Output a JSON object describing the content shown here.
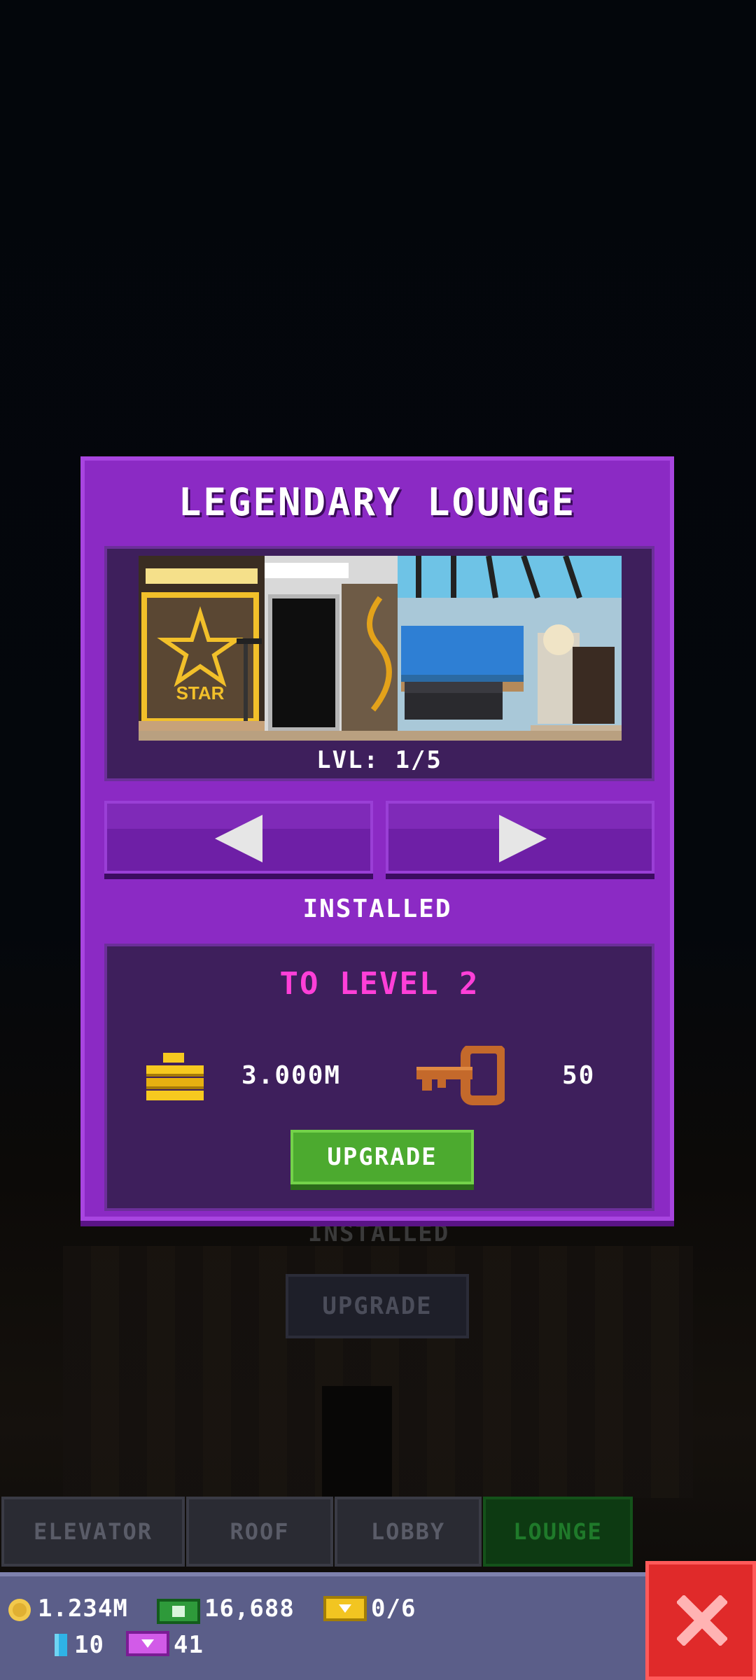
{
  "modal": {
    "title": "LEGENDARY LOUNGE",
    "preview": {
      "sign_text": "STAR"
    },
    "level_text": "LVL: 1/5",
    "status": "INSTALLED",
    "upgrade": {
      "heading": "TO LEVEL 2",
      "coin_cost": "3.000M",
      "key_cost": "50",
      "button_label": "UPGRADE"
    }
  },
  "background": {
    "installed_text": "INSTALLED",
    "upgrade_label": "UPGRADE"
  },
  "tabs": [
    {
      "label": "ELEVATOR",
      "active": false
    },
    {
      "label": "ROOF",
      "active": false
    },
    {
      "label": "LOBBY",
      "active": false
    },
    {
      "label": "LOUNGE",
      "active": true
    }
  ],
  "status_bar": {
    "coins": "1.234M",
    "bux": "16,688",
    "tickets": "0/6",
    "gems": "10",
    "vip_tickets": "41"
  },
  "colors": {
    "modal_purple": "#8b2ac4",
    "panel_dark": "#3e1f5c",
    "upgrade_green": "#4caa2f",
    "heading_pink": "#ff3fd8",
    "close_red": "#e02a2a"
  }
}
